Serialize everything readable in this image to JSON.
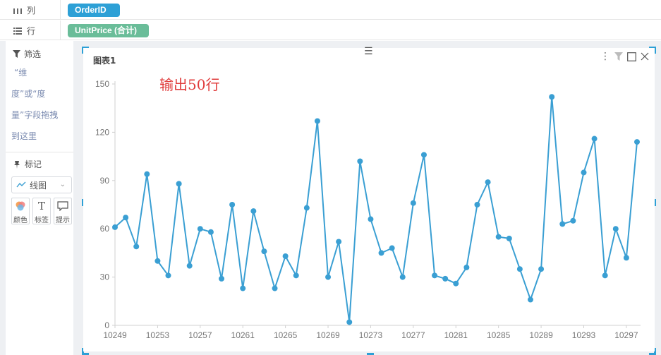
{
  "shelves": {
    "columns": {
      "label": "列",
      "icon": "columns-icon",
      "pill": "OrderID",
      "pill_color": "#2da0d6"
    },
    "rows": {
      "label": "行",
      "icon": "rows-icon",
      "pill": "UnitPrice (合计)",
      "pill_color": "#6abd99"
    }
  },
  "sidebar": {
    "filter_title": "筛选",
    "filter_hint_lines": [
      "“维",
      "度”或“度",
      "量”字段拖拽",
      "到这里"
    ],
    "marks_title": "标记",
    "mark_type": "线图",
    "mark_buttons": [
      {
        "label": "颜色",
        "icon": "color-icon"
      },
      {
        "label": "标签",
        "icon": "text-label-icon"
      },
      {
        "label": "提示",
        "icon": "tooltip-icon"
      }
    ]
  },
  "card": {
    "title": "图表1",
    "annotation": "输出50行"
  },
  "colors": {
    "series": "#3a9fd3",
    "accent": "#2da0d6",
    "annotation": "#e03c3c"
  },
  "chart_data": {
    "type": "line",
    "x": [
      10249,
      10250,
      10251,
      10252,
      10253,
      10254,
      10255,
      10256,
      10257,
      10258,
      10259,
      10260,
      10261,
      10262,
      10263,
      10264,
      10265,
      10266,
      10267,
      10268,
      10269,
      10270,
      10271,
      10272,
      10273,
      10274,
      10275,
      10276,
      10277,
      10278,
      10279,
      10280,
      10281,
      10282,
      10283,
      10284,
      10285,
      10286,
      10287,
      10288,
      10289,
      10290,
      10291,
      10292,
      10293,
      10294,
      10295,
      10296,
      10297,
      10298
    ],
    "values": [
      61,
      67,
      49,
      94,
      40,
      31,
      88,
      37,
      60,
      58,
      29,
      75,
      23,
      71,
      46,
      23,
      43,
      31,
      73,
      127,
      30,
      52,
      2,
      102,
      66,
      45,
      48,
      30,
      76,
      106,
      31,
      29,
      26,
      36,
      75,
      89,
      55,
      54,
      35,
      16,
      35,
      142,
      63,
      65,
      95,
      116,
      31,
      60,
      42,
      114
    ],
    "xticks": [
      10249,
      10253,
      10257,
      10261,
      10265,
      10269,
      10273,
      10277,
      10281,
      10285,
      10289,
      10293,
      10297
    ],
    "yticks": [
      0,
      30,
      60,
      90,
      120,
      150
    ],
    "ylim": [
      0,
      150
    ],
    "title": "",
    "xlabel": "",
    "ylabel": "",
    "grid": false,
    "marker": "circle"
  }
}
